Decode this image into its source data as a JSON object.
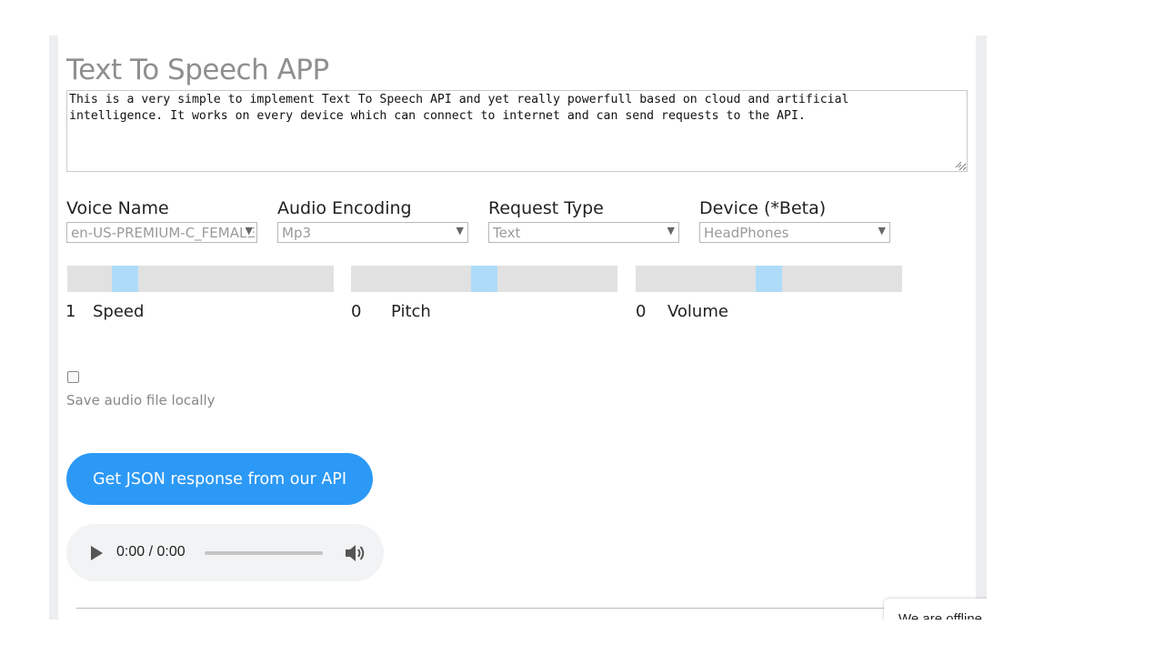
{
  "app": {
    "title": "Text To Speech APP",
    "text_input": "This is a very simple to implement Text To Speech API and yet really powerfull based on cloud and artificial\nintelligence. It works on every device which can connect to internet and can send requests to the API."
  },
  "fields": [
    {
      "label": "Voice Name",
      "value": "en-US-PREMIUM-C_FEMALE"
    },
    {
      "label": "Audio Encoding",
      "value": "Mp3"
    },
    {
      "label": "Request Type",
      "value": "Text"
    },
    {
      "label": "Device (*Beta)",
      "value": "HeadPhones"
    }
  ],
  "sliders": [
    {
      "label": "Speed",
      "value": "1"
    },
    {
      "label": "Pitch",
      "value": "0"
    },
    {
      "label": "Volume",
      "value": "0"
    }
  ],
  "save_local": {
    "label": "Save audio file locally",
    "checked": false
  },
  "api_button": {
    "label": "Get JSON response from our API"
  },
  "audio_player": {
    "time": "0:00 / 0:00"
  },
  "chat_widget": {
    "text": "We are offline"
  },
  "colors": {
    "accent": "#2c99f6",
    "slider_thumb": "#aedcf8",
    "slider_track": "#e1e1e1"
  },
  "icons": {
    "play": "play-icon",
    "volume": "volume-icon",
    "dropdown": "chevron-down-icon"
  }
}
